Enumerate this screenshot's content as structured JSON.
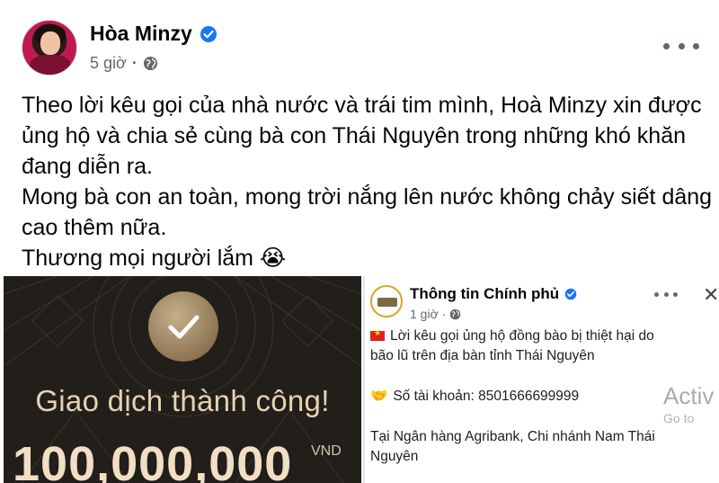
{
  "post": {
    "author_name": "Hòa Minzy",
    "time": "5 giờ",
    "privacy_icon": "globe-icon",
    "verified_icon": "verified-badge-icon",
    "more_icon": "more-options-icon",
    "text_lines": [
      "Theo lời kêu gọi của nhà nước và trái tim mình, Hoà Minzy xin được",
      "ủng hộ và chia sẻ cùng bà con Thái Nguyên trong những khó khăn",
      "đang diễn ra.",
      "Mong bà con an toàn, mong trời nắng lên nước không chảy siết dâng",
      "cao thêm nữa.",
      "Thương mọi người lắm 😭"
    ]
  },
  "transaction": {
    "status": "Giao dịch thành công!",
    "amount": "100,000,000",
    "currency": "VND",
    "icon": "checkmark-icon"
  },
  "shared_post": {
    "author_name": "Thông tin Chính phủ",
    "time": "1 giờ",
    "line1": "Lời kêu gọi ủng hộ đồng bào bị thiệt hại do",
    "line2": "bão lũ trên địa bàn tỉnh Thái Nguyên",
    "account_line": "Số tài khoản: 8501666699999",
    "bank_line1": "Tại Ngân hàng Agribank, Chi nhánh Nam Thái",
    "bank_line2": "Nguyên",
    "overlay_text": "Activ",
    "overlay_sub": "Go to"
  },
  "colors": {
    "verified_blue": "#1877f2",
    "secondary_text": "#65676b",
    "gold": "#e6d2b2"
  }
}
